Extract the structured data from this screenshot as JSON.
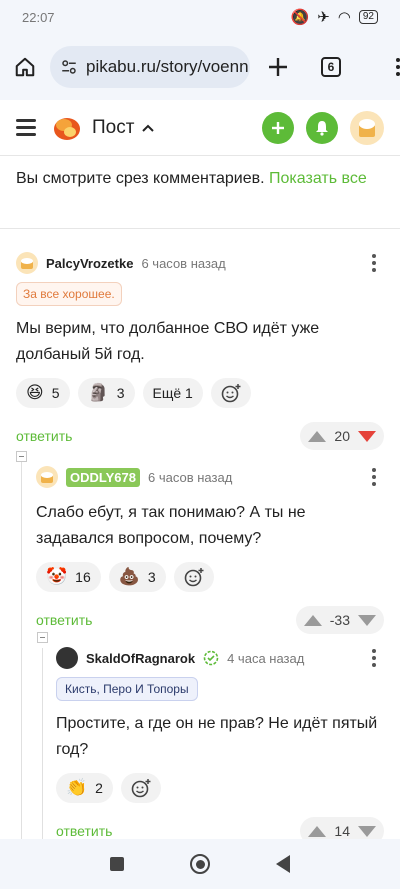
{
  "status": {
    "time": "22:07",
    "battery": "92"
  },
  "browser": {
    "url": "pikabu.ru/story/voenn",
    "tabs": "6"
  },
  "header": {
    "title": "Пост"
  },
  "notice": {
    "text": "Вы смотрите срез комментариев. ",
    "link": "Показать все"
  },
  "comments": [
    {
      "author": "PalcyVrozetke",
      "time": "6 часов назад",
      "tag": "За все хорошее.",
      "text": "Мы верим, что долбанное СВО идёт уже долбаный 5й год.",
      "reactions": [
        {
          "emoji": "😆",
          "count": "5"
        },
        {
          "emoji": "🗿",
          "count": "3"
        }
      ],
      "more_reactions": "Ещё 1",
      "reply": "ответить",
      "rating": "20"
    },
    {
      "author": "ODDLY678",
      "time": "6 часов назад",
      "text": "Слабо ебут, я так понимаю? А ты не задавался вопросом, почему?",
      "reactions": [
        {
          "emoji": "🤡",
          "count": "16"
        },
        {
          "emoji": "💩",
          "count": "3"
        }
      ],
      "reply": "ответить",
      "rating": "-33"
    },
    {
      "author": "SkaldOfRagnarok",
      "time": "4 часа назад",
      "tag": "Кисть, Перо И Топоры",
      "text": "Простите, а где он не прав? Не идёт пятый год?",
      "reactions": [
        {
          "emoji": "👏",
          "count": "2"
        }
      ],
      "reply": "ответить",
      "rating": "14"
    }
  ],
  "colors": {
    "accent": "#5dbb38",
    "downvote_active": "#e5433a"
  }
}
